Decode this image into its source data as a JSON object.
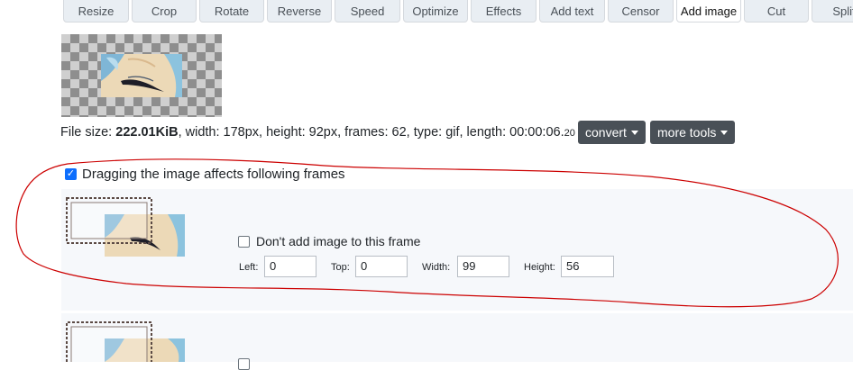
{
  "toolbar": {
    "tabs": [
      {
        "label": "Resize",
        "active": false
      },
      {
        "label": "Crop",
        "active": false
      },
      {
        "label": "Rotate",
        "active": false
      },
      {
        "label": "Reverse",
        "active": false
      },
      {
        "label": "Speed",
        "active": false
      },
      {
        "label": "Optimize",
        "active": false
      },
      {
        "label": "Effects",
        "active": false
      },
      {
        "label": "Add text",
        "active": false
      },
      {
        "label": "Censor",
        "active": false
      },
      {
        "label": "Add image",
        "active": true
      },
      {
        "label": "Cut",
        "active": false
      },
      {
        "label": "Split",
        "active": false
      }
    ]
  },
  "file_info": {
    "size_label": "File size: ",
    "size_value": "222.01KiB",
    "details": ", width: 178px, height: 92px, frames: 62, type: gif, length: 00:00:06.",
    "length_fraction": "20"
  },
  "buttons": {
    "convert": "convert",
    "more_tools": "more tools"
  },
  "drag_option": {
    "label": "Dragging the image affects following frames",
    "checked": true
  },
  "frame": {
    "no_add_label": "Don't add image to this frame",
    "no_add_checked": false,
    "left_label": "Left:",
    "left_value": "0",
    "top_label": "Top:",
    "top_value": "0",
    "width_label": "Width:",
    "width_value": "99",
    "height_label": "Height:",
    "height_value": "56"
  },
  "colors": {
    "accent": "#0d6efd",
    "dark_button": "#495057",
    "annotation": "#cc0000"
  }
}
